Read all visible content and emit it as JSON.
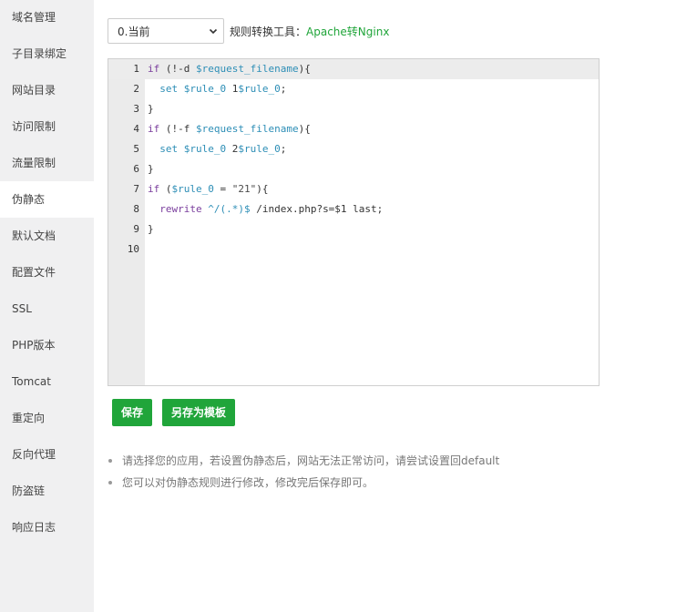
{
  "sidebar": {
    "items": [
      {
        "label": "域名管理"
      },
      {
        "label": "子目录绑定"
      },
      {
        "label": "网站目录"
      },
      {
        "label": "访问限制"
      },
      {
        "label": "流量限制"
      },
      {
        "label": "伪静态",
        "active": true
      },
      {
        "label": "默认文档"
      },
      {
        "label": "配置文件"
      },
      {
        "label": "SSL"
      },
      {
        "label": "PHP版本"
      },
      {
        "label": "Tomcat"
      },
      {
        "label": "重定向"
      },
      {
        "label": "反向代理"
      },
      {
        "label": "防盗链"
      },
      {
        "label": "响应日志"
      }
    ]
  },
  "toolbar": {
    "select_value": "0.当前",
    "tool_label": "规则转换工具：",
    "tool_link": "Apache转Nginx"
  },
  "editor": {
    "line_numbers": [
      "1",
      "2",
      "3",
      "4",
      "5",
      "6",
      "7",
      "8",
      "9",
      "10"
    ],
    "lines": [
      "if (!-d $request_filename){",
      "  set $rule_0 1$rule_0;",
      "}",
      "if (!-f $request_filename){",
      "  set $rule_0 2$rule_0;",
      "}",
      "if ($rule_0 = \"21\"){",
      "  rewrite ^/(.*)$ /index.php?s=$1 last;",
      "}",
      ""
    ]
  },
  "buttons": {
    "save_label": "保存",
    "save_template_label": "另存为模板"
  },
  "tips": [
    "请选择您的应用，若设置伪静态后，网站无法正常访问，请尝试设置回default",
    "您可以对伪静态规则进行修改，修改完后保存即可。"
  ],
  "colors": {
    "accent": "#20a53a",
    "sidebar_bg": "#f0f0f1",
    "gutter_bg": "#ebebeb"
  }
}
